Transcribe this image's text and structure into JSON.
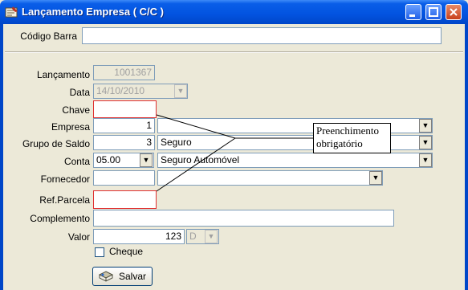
{
  "window": {
    "title": "Lançamento Empresa ( C/C )"
  },
  "barcode": {
    "label": "Código Barra",
    "value": ""
  },
  "form": {
    "lancamento": {
      "label": "Lançamento",
      "value": "1001367"
    },
    "data": {
      "label": "Data",
      "value": "14/10/2010"
    },
    "chave": {
      "label": "Chave",
      "value": ""
    },
    "empresa": {
      "label": "Empresa",
      "value": "1",
      "name": ""
    },
    "grupo_saldo": {
      "label": "Grupo de Saldo",
      "value": "3",
      "name": "Seguro"
    },
    "conta": {
      "label": "Conta",
      "value": "05.00",
      "name": "Seguro Automóvel"
    },
    "fornecedor": {
      "label": "Fornecedor",
      "value": "",
      "name": ""
    },
    "ref_parcela": {
      "label": "Ref.Parcela",
      "value": ""
    },
    "complemento": {
      "label": "Complemento",
      "value": ""
    },
    "valor": {
      "label": "Valor",
      "value": "123",
      "type": "D"
    },
    "cheque": {
      "label": "Cheque",
      "checked": false
    }
  },
  "buttons": {
    "save": "Salvar"
  },
  "annotation": {
    "line1": "Preenchimento",
    "line2": "obrigatório"
  },
  "icons": [
    "window-icon",
    "minimize-icon",
    "maximize-icon",
    "close-icon",
    "dropdown-arrow-icon",
    "save-icon"
  ]
}
